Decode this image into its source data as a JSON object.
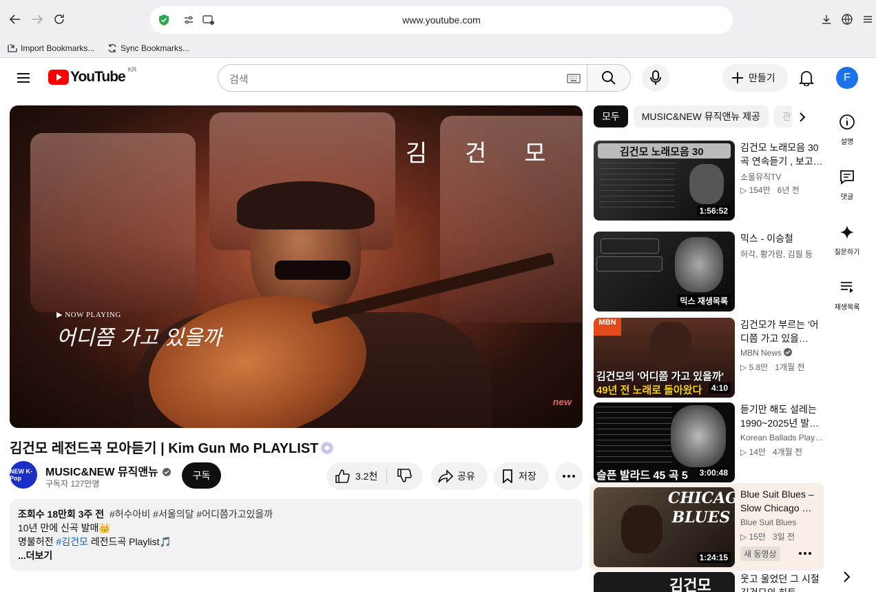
{
  "browser": {
    "url": "www.youtube.com",
    "bookmarks": [
      {
        "label": "Import Bookmarks..."
      },
      {
        "label": "Sync Bookmarks..."
      }
    ]
  },
  "header": {
    "logo_text": "YouTube",
    "region": "KR",
    "search_placeholder": "검색",
    "create_label": "만들기",
    "avatar_letter": "F"
  },
  "video": {
    "now_playing": "▶ NOW PLAYING",
    "overlay_song": "어디쯤 가고 있을까",
    "overlay_name": "김 건 모",
    "watermark": "new",
    "title": "김건모 레전드곡 모아듣기 | Kim Gun Mo PLAYLIST",
    "channel": "MUSIC&NEW 뮤직앤뉴",
    "channel_avatar": "NEW K-Pop",
    "subscribers": "구독자 127만명",
    "subscribe_label": "구독",
    "likes": "3.2천",
    "share_label": "공유",
    "save_label": "저장",
    "description": {
      "views_date": "조회수 18만회  3주 전",
      "hashtags": "#허수아비 #서울의달 #어디쯤가고있을까",
      "line1": "10년 만에 신곡 발매👑",
      "line2_prefix": "명불허전 ",
      "line2_tag": "#김건모",
      "line2_suffix": " 레전드곡 Playlist🎵",
      "more": "...더보기"
    }
  },
  "chips": [
    "모두",
    "MUSIC&NEW 뮤직앤뉴 제공",
    "관"
  ],
  "recommendations": [
    {
      "title": "김건모 노래모음 30곡 연속듣기 , 보고…",
      "channel": "소울뮤직TV",
      "views": "▷ 154만",
      "age": "6년 전",
      "duration": "1:56:52",
      "thumb_text": "김건모 노래모음 30",
      "thumb_color": "#2a2a2a"
    },
    {
      "title": "믹스 - 이승철",
      "channel": "허각, 황가람, 김필 등",
      "views": "",
      "age": "",
      "duration": "믹스 재생목록",
      "thumb_text": "",
      "thumb_color": "#1a1a1a"
    },
    {
      "title": "김건모가 부르는 '어디쯤 가고 있을…",
      "channel": "MBN News",
      "views": "▷ 5.8만",
      "age": "1개월 전",
      "duration": "4:10",
      "thumb_text": "김건모의 '어디쯤 가고 있을까'",
      "thumb_sub": "49년 전 노래로 돌아왔다",
      "thumb_color": "#4a2a20"
    },
    {
      "title": "듣기만 해도 설레는 1990~2025년 발…",
      "channel": "Korean Ballads Play…",
      "views": "▷ 14만",
      "age": "4개월 전",
      "duration": "3:00:48",
      "thumb_text": "슬픈 발라드 45 곡 5",
      "thumb_color": "#111"
    },
    {
      "title": "Blue Suit Blues – Slow Chicago …",
      "channel": "Blue Suit Blues",
      "views": "▷ 15만",
      "age": "3일 전",
      "duration": "1:24:15",
      "thumb_text": "CHICAGO BLUES",
      "badge": "새 동영상",
      "thumb_color": "#3a3028"
    },
    {
      "title": "웃고 울었던 그 시절 김건모의 히트…",
      "channel": "",
      "views": "",
      "age": "",
      "duration": "",
      "thumb_text": "김건모",
      "thumb_color": "#222"
    }
  ],
  "rail": [
    {
      "label": "설명",
      "icon": "info-icon"
    },
    {
      "label": "댓글",
      "icon": "comment-icon"
    },
    {
      "label": "질문하기",
      "icon": "sparkle-icon"
    },
    {
      "label": "재생목록",
      "icon": "playlist-icon"
    }
  ],
  "colors": {
    "brand_red": "#ff0000",
    "accent_blue": "#065fd4"
  }
}
